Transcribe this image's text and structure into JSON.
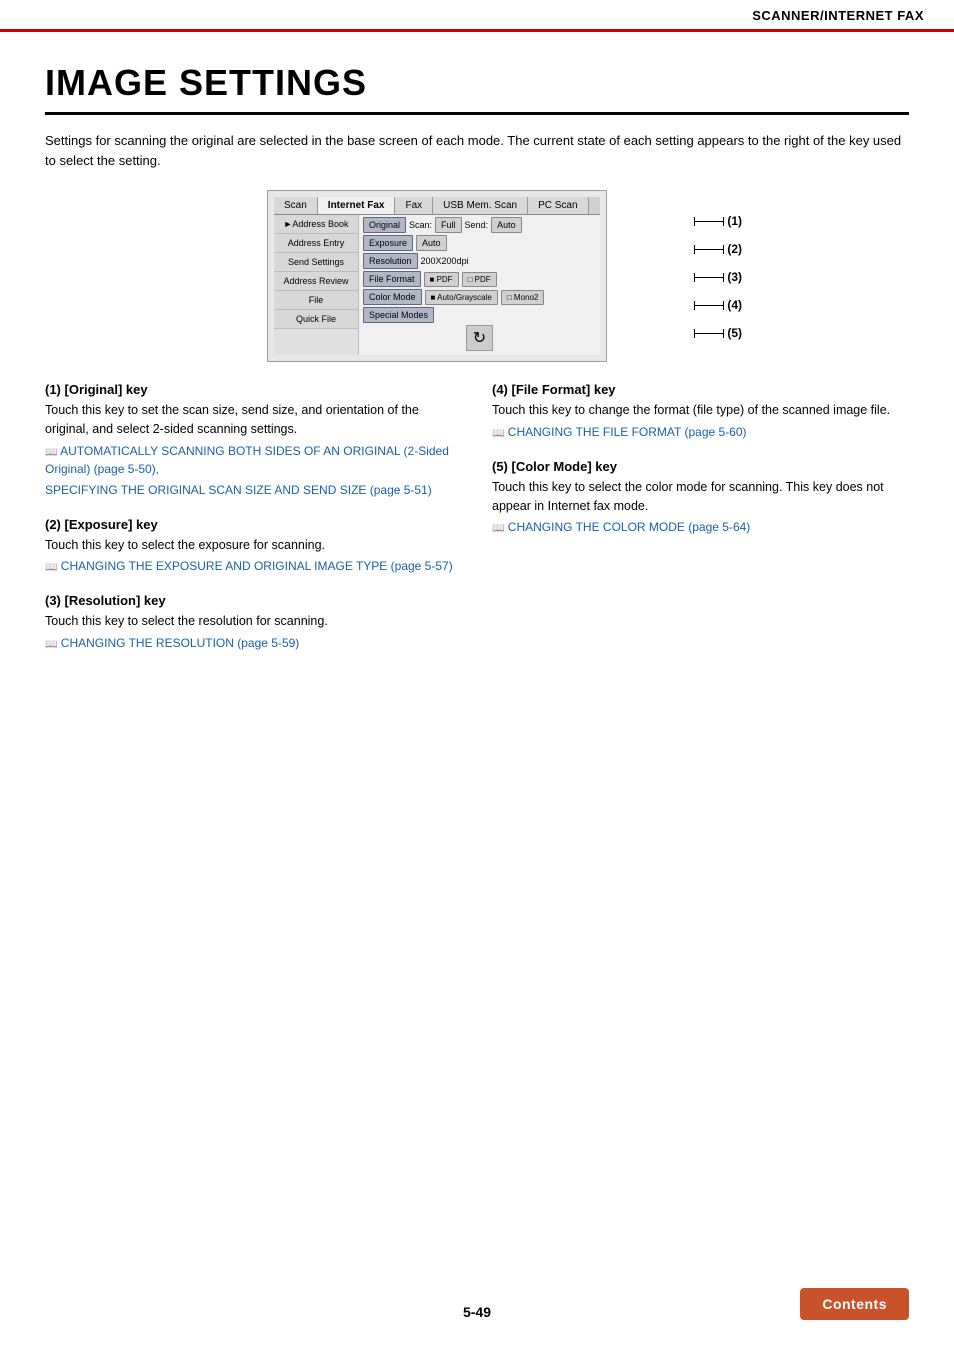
{
  "header": {
    "title": "SCANNER/INTERNET FAX"
  },
  "page": {
    "title": "IMAGE SETTINGS",
    "intro": "Settings for scanning the original are selected in the base screen of each mode. The current state of each setting appears to the right of the key used to select the setting."
  },
  "screen": {
    "tabs": [
      "Scan",
      "Internet Fax",
      "Fax",
      "USB Mem. Scan",
      "PC Scan"
    ],
    "left_items": [
      "Address Book",
      "Address Entry",
      "Send Settings",
      "Address Review",
      "File",
      "Quick File"
    ],
    "rows": [
      {
        "buttons": [
          "Original",
          "Scan:",
          "Full",
          "Send:",
          "Auto"
        ],
        "callout": "(1)"
      },
      {
        "buttons": [
          "Exposure",
          "Auto"
        ],
        "callout": "(2)"
      },
      {
        "buttons": [
          "Resolution",
          "200X200dpi"
        ],
        "callout": "(3)"
      },
      {
        "buttons": [
          "File Format",
          "PDF",
          "PDF"
        ],
        "callout": "(4)"
      },
      {
        "buttons": [
          "Color Mode",
          "Auto/Grayscale",
          "Mono2"
        ],
        "callout": "(5)"
      },
      {
        "buttons": [
          "Special Modes"
        ],
        "callout": ""
      }
    ]
  },
  "callouts": [
    "(1)",
    "(2)",
    "(3)",
    "(4)",
    "(5)"
  ],
  "descriptions": {
    "left": [
      {
        "id": "(1)",
        "header": "(1)  [Original] key",
        "body": "Touch this key to set the scan size, send size, and orientation of the original, and select 2-sided scanning settings.",
        "links": [
          "AUTOMATICALLY SCANNING BOTH SIDES OF AN ORIGINAL (2-Sided Original) (page 5-50),",
          "SPECIFYING THE ORIGINAL SCAN SIZE AND SEND SIZE (page 5-51)"
        ]
      },
      {
        "id": "(2)",
        "header": "(2)  [Exposure] key",
        "body": "Touch this key to select the exposure for scanning.",
        "links": [
          "CHANGING THE EXPOSURE AND ORIGINAL IMAGE TYPE (page 5-57)"
        ]
      },
      {
        "id": "(3)",
        "header": "(3)  [Resolution] key",
        "body": "Touch this key to select the resolution for scanning.",
        "links": [
          "CHANGING THE RESOLUTION (page 5-59)"
        ]
      }
    ],
    "right": [
      {
        "id": "(4)",
        "header": "(4)  [File Format] key",
        "body": "Touch this key to change the format (file type) of the scanned image file.",
        "links": [
          "CHANGING THE FILE FORMAT (page 5-60)"
        ]
      },
      {
        "id": "(5)",
        "header": "(5)  [Color Mode] key",
        "body": "Touch this key to select the color mode for scanning. This key does not appear in Internet fax mode.",
        "links": [
          "CHANGING THE COLOR MODE (page 5-64)"
        ]
      }
    ]
  },
  "footer": {
    "page_number": "5-49",
    "contents_label": "Contents"
  }
}
